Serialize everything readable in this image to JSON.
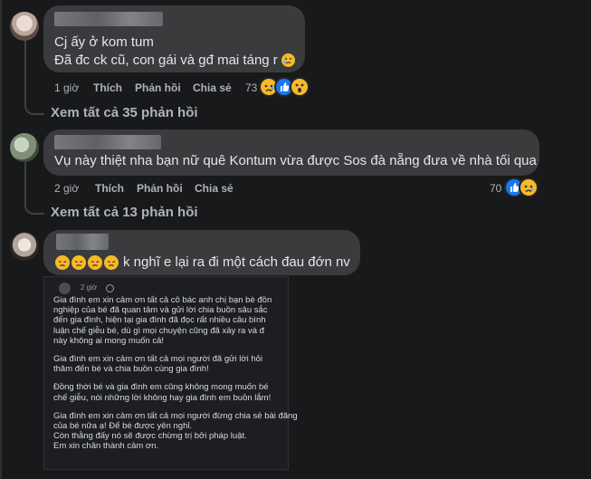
{
  "comments": [
    {
      "text_lines": [
        "Cj ấy ở kom tum",
        "Đã đc ck cũ, con gái và gđ mai táng r"
      ],
      "time": "1 giờ",
      "like_label": "Thích",
      "reply_label": "Phản hồi",
      "share_label": "Chia sẻ",
      "reaction_count": "73",
      "view_replies": "Xem tất cả 35 phản hồi"
    },
    {
      "text_lines": [
        "Vụ này thiệt nha bạn nữ quê Kontum vừa được Sos đà nẵng đưa về nhà tối qua"
      ],
      "time": "2 giờ",
      "like_label": "Thích",
      "reply_label": "Phản hồi",
      "share_label": "Chia sẻ",
      "reaction_count": "70",
      "view_replies": "Xem tất cả 13 phản hồi"
    },
    {
      "text_lines": [
        "k nghĩ e lại ra đi một cách đau đớn nv"
      ]
    }
  ],
  "attached_screenshot": {
    "time": "2 giờ",
    "lines": [
      "Gia đình em xin cảm ơn tất cả cô bác anh chị bạn bè đồn",
      "nghiệp của bé đã quan tâm và gửi lời chia buồn sâu sắc",
      "đến gia đình, hiện tại gia đình đã đọc rất nhiều câu bình",
      "luận chế giễu bé, dù gì mọi chuyện cũng đã xảy ra và đ",
      "này không ai mong muốn cả!",
      "",
      "Gia đình em xin cảm ơn tất cả mọi người đã gửi lời hỏi",
      "thăm đến bé và chia buồn cùng gia đình!",
      "",
      "Đồng thời bé và gia đình em cũng không mong muốn bé",
      "chế giễu, nói những lời không hay gia đình em buồn lắm!",
      "",
      "Gia đình em xin cảm ơn tất cả mọi người đừng chia sẻ bài đăng",
      "của bé nữa ạ! Để bé được yên nghỉ.",
      "Còn thằng đấy nó sẽ được chừng trị bởi pháp luật.",
      "Em xin chân thành cảm ơn."
    ]
  },
  "colors": {
    "background": "#18191a",
    "bubble": "#3a3b3c",
    "secondary_text": "#b0b3b8",
    "like_blue": "#1877f2",
    "emoji_yellow": "#f7b928"
  },
  "icons": [
    "sad-reaction-icon",
    "like-reaction-icon",
    "wow-reaction-icon",
    "pensive-emoji-icon",
    "crying-emoji-icon"
  ]
}
